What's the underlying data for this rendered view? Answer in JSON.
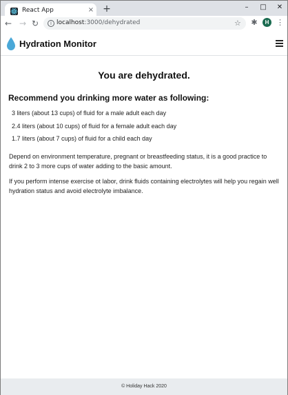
{
  "browser": {
    "tab_title": "React App",
    "tab_close": "×",
    "new_tab": "+",
    "window_minimize": "–",
    "window_maximize": "□",
    "window_close": "✕",
    "back": "←",
    "forward": "→",
    "reload": "↻",
    "url_host": "localhost",
    "url_path": ":3000/dehydrated",
    "bookmark_icon": "☆",
    "extensions_icon": "✱",
    "profile_initial": "H",
    "menu_icon": "⋮"
  },
  "app": {
    "brand": "Hydration Monitor",
    "accent": "#4aa8d8"
  },
  "main": {
    "heading": "You are dehydrated.",
    "subheading": "Recommend you drinking more water as following:",
    "recommendations": [
      "3 liters (about 13 cups) of fluid for a male adult each day",
      "2.4 liters (about 10 cups) of fluid for a female adult each day",
      "1.7 liters (about 7 cups) of fluid for a child each day"
    ],
    "paragraph1": "Depend on environment temperature, pregnant or breastfeeding status, it is a good practice to drink 2 to 3 more cups of water adding to the basic amount.",
    "paragraph2": "If you perform intense exercise ot labor, drink fluids containing electrolytes will help you regain well hydration status and avoid electrolyte imbalance."
  },
  "footer": {
    "text": "© Holiday Hack 2020"
  }
}
